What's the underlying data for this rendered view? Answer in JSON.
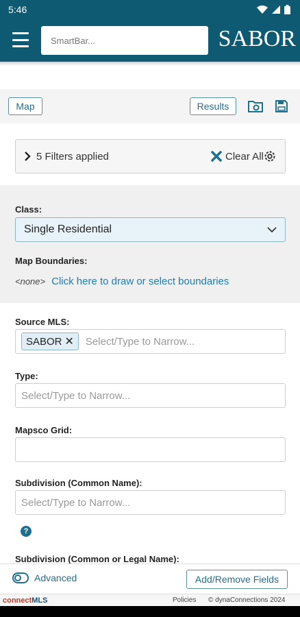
{
  "status_bar": {
    "time": "5:46"
  },
  "header": {
    "smartbar_placeholder": "SmartBar...",
    "logo": "SABOR"
  },
  "toolbar": {
    "map_label": "Map",
    "results_label": "Results"
  },
  "filters": {
    "applied_label": "5 Filters applied",
    "clear_all_label": "Clear All"
  },
  "class_field": {
    "label": "Class:",
    "value": "Single Residential"
  },
  "map_boundaries": {
    "label": "Map Boundaries:",
    "none_text": "<none>",
    "link_text": "Click here to draw or select boundaries"
  },
  "source_mls": {
    "label": "Source MLS:",
    "chip": "SABOR",
    "placeholder": "Select/Type to Narrow..."
  },
  "type_field": {
    "label": "Type:",
    "placeholder": "Select/Type to Narrow..."
  },
  "mapsco_grid": {
    "label": "Mapsco Grid:",
    "value": ""
  },
  "subdivision_common": {
    "label": "Subdivision (Common Name):",
    "placeholder": "Select/Type to Narrow..."
  },
  "next_field_label": "Subdivision (Common or Legal Name):",
  "bottom_bar": {
    "advanced_label": "Advanced",
    "add_remove_label": "Add/Remove Fields"
  },
  "footer": {
    "brand_part1": "connect",
    "brand_part2": "MLS",
    "policies": "Policies",
    "copyright": "© dynaConnections 2024"
  },
  "colors": {
    "header_bg": "#0e5a73",
    "accent": "#1f6f8e",
    "link": "#1f7bb0"
  }
}
